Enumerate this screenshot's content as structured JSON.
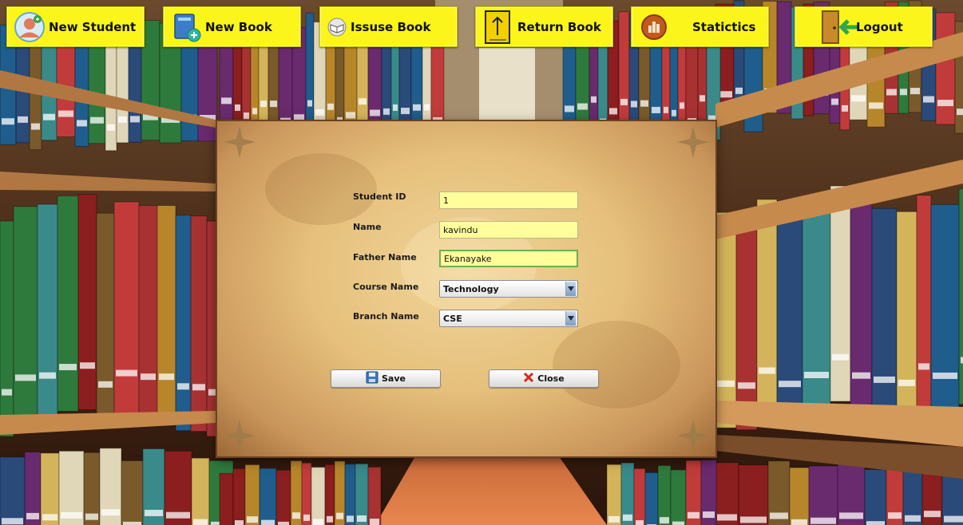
{
  "toolbar": {
    "new_student": "New Student",
    "new_book": "New Book",
    "issue_book": "Issuse Book",
    "return_book": "Return Book",
    "statistics": "Statictics",
    "logout": "Logout"
  },
  "form": {
    "student_id_label": "Student ID",
    "student_id_value": "1",
    "name_label": "Name",
    "name_value": "kavindu",
    "father_name_label": "Father Name",
    "father_name_value": "Ekanayake",
    "course_name_label": "Course Name",
    "course_name_value": "Technology",
    "branch_name_label": "Branch Name",
    "branch_name_value": "CSE",
    "save_label": "Save",
    "close_label": "Close"
  },
  "colors": {
    "toolbar_button": "#fbf51b",
    "input_background": "#fffe9a",
    "parchment": "#e6c07c"
  },
  "icons": {
    "new_student": "student-avatar-icon",
    "new_book": "book-add-icon",
    "issue_book": "book-open-icon",
    "return_book": "book-return-icon",
    "statistics": "stats-icon",
    "logout": "door-exit-icon",
    "save": "floppy-disk-icon",
    "close": "red-x-icon"
  }
}
